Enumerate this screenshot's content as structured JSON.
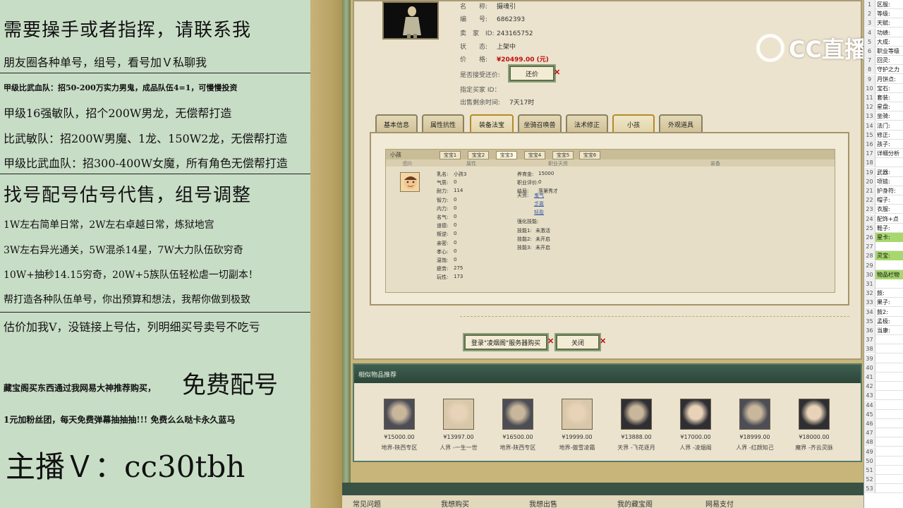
{
  "left_panel": {
    "lines": [
      "需要操手或者指挥，请联系我",
      "朋友圈各种单号，组号，看号加Ｖ私聊我",
      "甲级比武血队：招50-200万实力男鬼，成品队伍4=1，可慢慢投资",
      "甲级16强敏队，招个200W男龙，无偿帮打造",
      "比武敏队：招200W男魔、1龙、150W2龙，无偿帮打造",
      "甲级比武血队：招300-400W女魔，所有角色无偿帮打造",
      "找号配号估号代售，组号调整",
      "1W左右简单日常，2W左右卓越日常，炼狱地宫",
      "3W左右异光通关，5W混杀14星，7W大力队伍砍穷奇",
      "10W+抽秒14.15穷奇，20W+5族队伍轻松虐一切副本！",
      "帮打造各种队伍单号，你出预算和想法，我帮你做到极致",
      "估价加我V，没链接上号估，列明细买号卖号不吃亏",
      "藏宝阁买东西通过我网易大神推荐购买，",
      "免费配号",
      "1元加粉丝团，每天免费弹幕抽抽抽!!! 免费么么哒卡永久蓝马",
      "主播Ｖ：cc30tbh"
    ]
  },
  "detail": {
    "name_label": "名　　称:",
    "name": "摄魂引",
    "id_label": "编　　号:",
    "id": "6862393",
    "seller_label": "卖　家　ID:",
    "seller_id": "243165752",
    "status_label": "状　　态:",
    "status": "上架中",
    "price_label": "价　　格:",
    "price": "¥20499.00 (元)",
    "counter_label": "是否接受还价:",
    "counter_button": "还价",
    "buyer_label": "指定买家 ID：",
    "remaining_label": "出售剩余时间:",
    "remaining": "7天17时"
  },
  "tabs": [
    "基本信息",
    "属性抗性",
    "装备法宝",
    "坐骑召唤兽",
    "法术修正",
    "小孩",
    "外观道具"
  ],
  "child_panel": {
    "title": "小孩",
    "subtabs": [
      "宝宝1",
      "宝宝2",
      "宝宝3",
      "宝宝4",
      "宝宝5",
      "宝宝6"
    ],
    "columns": [
      "图片",
      "属性",
      "职业天资",
      "装备"
    ],
    "left_attrs": [
      [
        "乳名:",
        "小孩3"
      ],
      [
        "气质:",
        "0"
      ],
      [
        "耐力:",
        "114"
      ],
      [
        "智力:",
        "0"
      ],
      [
        "内力:",
        "0"
      ],
      [
        "名气:",
        "0"
      ],
      [
        "道德:",
        "0"
      ],
      [
        "叛逆:",
        "0"
      ],
      [
        "亲密:",
        "0"
      ],
      [
        "孝心:",
        "0"
      ],
      [
        "温饱:",
        "0"
      ],
      [
        "疲劳:",
        "275"
      ],
      [
        "玩性:",
        "173"
      ]
    ],
    "right_attrs": [
      [
        "养育金:",
        "15000"
      ],
      [
        "职业评价:",
        "0"
      ],
      [
        "结局:",
        "落第秀才"
      ]
    ],
    "talent_label": "天资:",
    "talents": [
      "鬼气",
      "乏嘉",
      "轻盈"
    ],
    "strengthen_label": "强化技能:",
    "skills": [
      [
        "技能1:",
        "未激活"
      ],
      [
        "技能2:",
        "未开启"
      ],
      [
        "技能3:",
        "未开启"
      ]
    ]
  },
  "actions": {
    "buy_button": "登录\"凌烟阁\"服务器购买",
    "close_button": "关闭"
  },
  "recommend": {
    "title": "相似物品推荐",
    "items": [
      {
        "price": "¥15000.00",
        "server": "地界-陕西专区"
      },
      {
        "price": "¥13997.00",
        "server": "人界 -一生一世"
      },
      {
        "price": "¥16500.00",
        "server": "地界-陕西专区"
      },
      {
        "price": "¥19999.00",
        "server": "地界-傲雪凌霜"
      },
      {
        "price": "¥13888.00",
        "server": "天界 -飞花逐月"
      },
      {
        "price": "¥17000.00",
        "server": "人界 -凌烟阁"
      },
      {
        "price": "¥18999.00",
        "server": "人界 -红颜知己"
      },
      {
        "price": "¥18000.00",
        "server": "魔界 -齐云灵脉"
      }
    ]
  },
  "bottom_nav": [
    "常见问题",
    "我想购买",
    "我想出售",
    "我的藏宝阁",
    "网易支付"
  ],
  "logo_text": "CC直播",
  "sheet": {
    "rows": [
      {
        "n": "1",
        "v": "区服:"
      },
      {
        "n": "2",
        "v": "等级:"
      },
      {
        "n": "3",
        "v": "天赋:"
      },
      {
        "n": "4",
        "v": "功绩:"
      },
      {
        "n": "5",
        "v": "大成:"
      },
      {
        "n": "6",
        "v": "职业等级"
      },
      {
        "n": "7",
        "v": "回灵:"
      },
      {
        "n": "8",
        "v": "守护之力"
      },
      {
        "n": "9",
        "v": "月饼点:"
      },
      {
        "n": "10",
        "v": "宝石:"
      },
      {
        "n": "11",
        "v": "套装:"
      },
      {
        "n": "12",
        "v": "星盘:"
      },
      {
        "n": "13",
        "v": "坐骑:"
      },
      {
        "n": "14",
        "v": "法门:"
      },
      {
        "n": "15",
        "v": "修正:"
      },
      {
        "n": "16",
        "v": "孩子:"
      },
      {
        "n": "17",
        "v": "详细分析"
      },
      {
        "n": "18",
        "v": ""
      },
      {
        "n": "19",
        "v": "武器:"
      },
      {
        "n": "20",
        "v": "项链:"
      },
      {
        "n": "21",
        "v": "护身符:"
      },
      {
        "n": "22",
        "v": "帽子:"
      },
      {
        "n": "23",
        "v": "衣服:"
      },
      {
        "n": "24",
        "v": "配饰+点"
      },
      {
        "n": "25",
        "v": "鞋子:"
      },
      {
        "n": "26",
        "v": "星卡:",
        "hl": true
      },
      {
        "n": "27",
        "v": ""
      },
      {
        "n": "28",
        "v": "灵宝:",
        "hl": true
      },
      {
        "n": "29",
        "v": ""
      },
      {
        "n": "30",
        "v": "物品栏物",
        "hl": true
      },
      {
        "n": "31",
        "v": ""
      },
      {
        "n": "32",
        "v": "鼓:"
      },
      {
        "n": "33",
        "v": "果子:"
      },
      {
        "n": "34",
        "v": "鼓2:"
      },
      {
        "n": "35",
        "v": "孟极:"
      },
      {
        "n": "36",
        "v": "当康:"
      },
      {
        "n": "37",
        "v": ""
      },
      {
        "n": "38",
        "v": ""
      },
      {
        "n": "39",
        "v": ""
      },
      {
        "n": "40",
        "v": ""
      },
      {
        "n": "41",
        "v": ""
      },
      {
        "n": "42",
        "v": ""
      },
      {
        "n": "43",
        "v": ""
      },
      {
        "n": "44",
        "v": ""
      },
      {
        "n": "45",
        "v": ""
      },
      {
        "n": "46",
        "v": ""
      },
      {
        "n": "47",
        "v": ""
      },
      {
        "n": "48",
        "v": ""
      },
      {
        "n": "49",
        "v": ""
      },
      {
        "n": "50",
        "v": ""
      },
      {
        "n": "51",
        "v": ""
      },
      {
        "n": "52",
        "v": ""
      },
      {
        "n": "53",
        "v": ""
      }
    ]
  }
}
